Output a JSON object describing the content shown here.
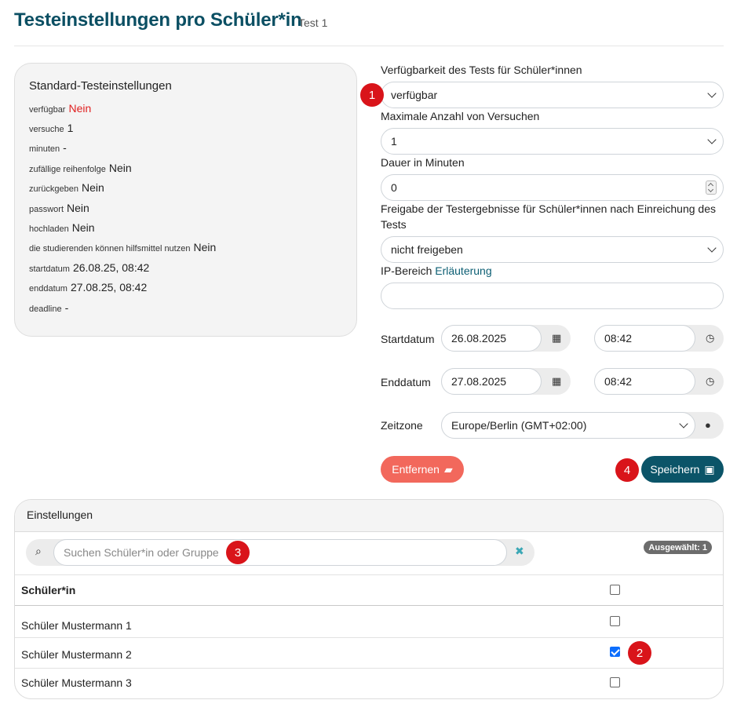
{
  "header": {
    "title": "Testeinstellungen pro Schüler*in",
    "subtitle": "Test 1"
  },
  "standard": {
    "title": "Standard-Testeinstellungen",
    "rows": [
      {
        "key": "verfügbar",
        "value": "Nein"
      },
      {
        "key": "versuche",
        "value": "1"
      },
      {
        "key": "minuten",
        "value": "-"
      },
      {
        "key": "zufällige reihenfolge",
        "value": "Nein"
      },
      {
        "key": "zurückgeben",
        "value": "Nein"
      },
      {
        "key": "passwort",
        "value": "Nein"
      },
      {
        "key": "hochladen",
        "value": "Nein"
      },
      {
        "key": "die studierenden können hilfsmittel nutzen",
        "value": "Nein"
      },
      {
        "key": "startdatum",
        "value": "26.08.25, 08:42"
      },
      {
        "key": "enddatum",
        "value": "27.08.25, 08:42"
      },
      {
        "key": "deadline",
        "value": "-"
      }
    ]
  },
  "form": {
    "availability": {
      "label": "Verfügbarkeit des Tests für Schüler*innen",
      "value": "verfügbar"
    },
    "attempts": {
      "label": "Maximale Anzahl von Versuchen",
      "value": "1"
    },
    "duration": {
      "label": "Dauer in Minuten",
      "value": "0"
    },
    "release": {
      "label_line1": "Freigabe der Testergebnisse für Schüler*innen nach Einreichung des",
      "label_line2": "Tests",
      "value": "nicht freigeben"
    },
    "ip": {
      "label": "IP-Bereich",
      "link": "Erläuterung",
      "value": ""
    },
    "start": {
      "label": "Startdatum",
      "date": "26.08.2025",
      "time": "08:42"
    },
    "end": {
      "label": "Enddatum",
      "date": "27.08.2025",
      "time": "08:42"
    },
    "timezone": {
      "label": "Zeitzone",
      "value": "Europe/Berlin (GMT+02:00)"
    },
    "remove_label": "Entfernen",
    "save_label": "Speichern"
  },
  "badges": {
    "b1": "1",
    "b2": "2",
    "b3": "3",
    "b4": "4"
  },
  "settings": {
    "title": "Einstellungen",
    "search_placeholder": "Suchen Schüler*in oder Gruppe",
    "selected": "Ausgewählt: 1",
    "column": "Schüler*in",
    "students": [
      {
        "name": "Schüler Mustermann 1",
        "checked": false
      },
      {
        "name": "Schüler Mustermann 2",
        "checked": true
      },
      {
        "name": "Schüler Mustermann 3",
        "checked": false
      }
    ]
  }
}
